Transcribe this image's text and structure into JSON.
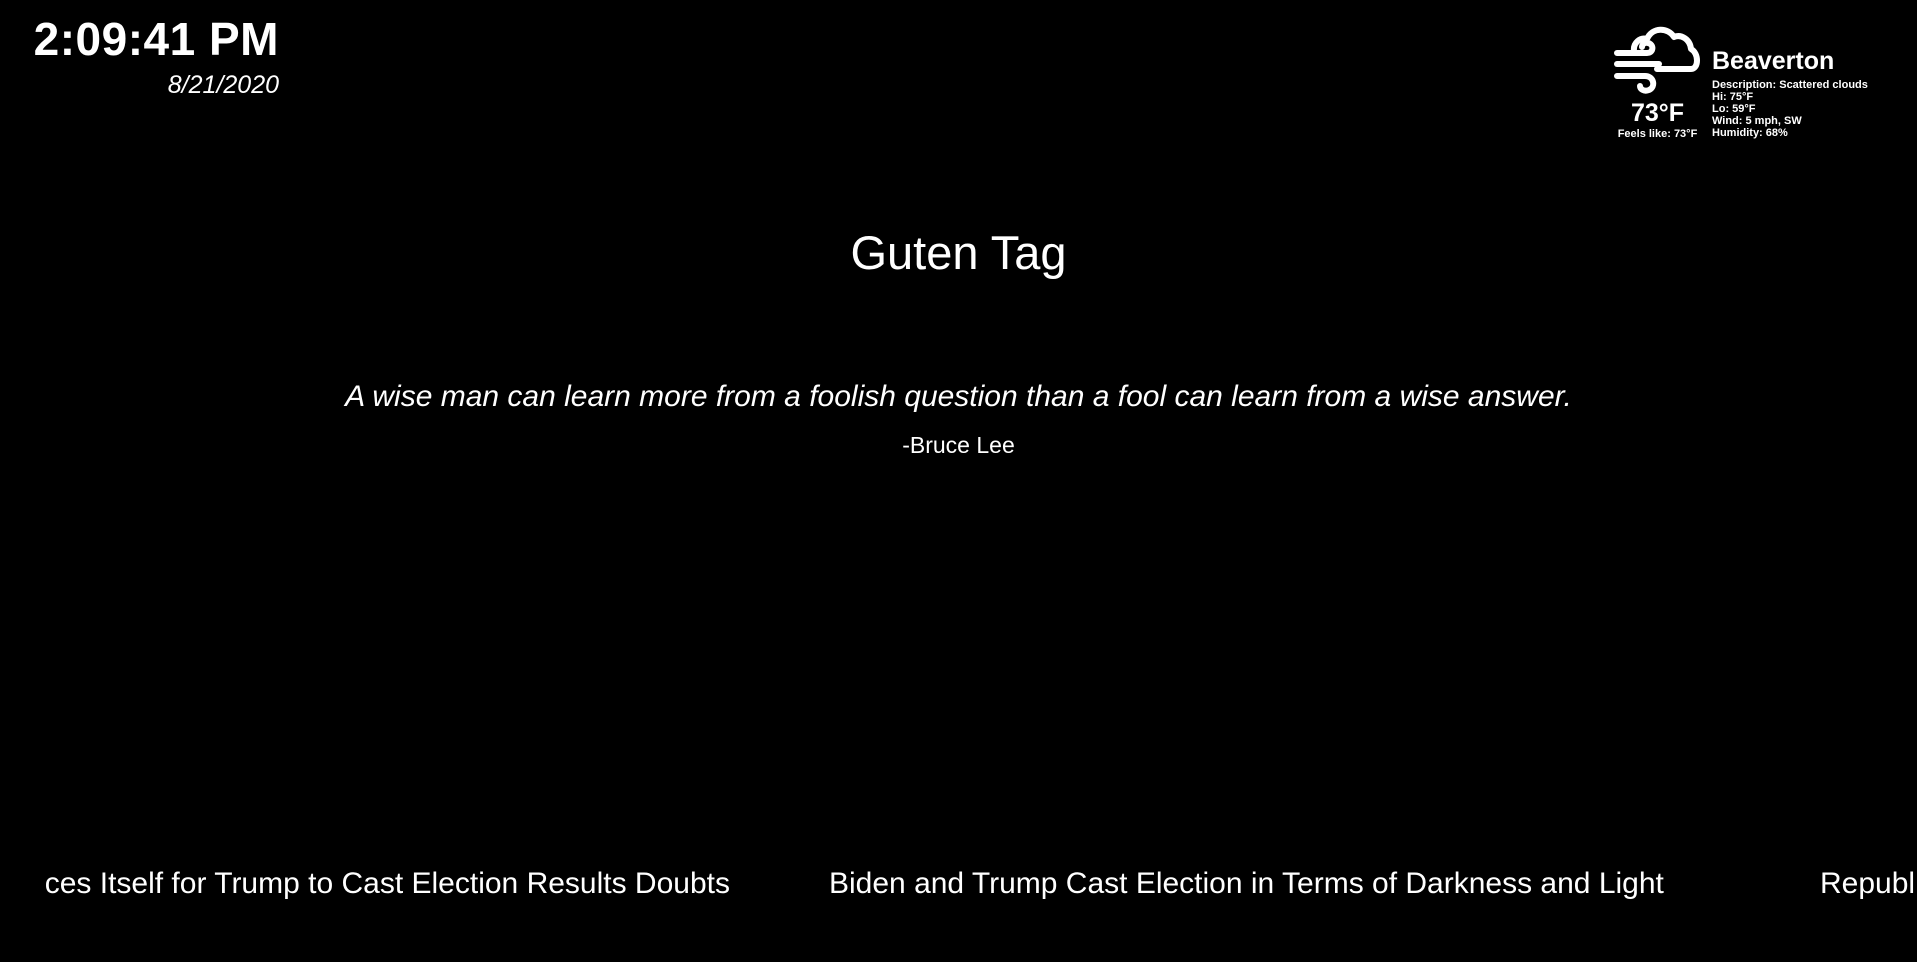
{
  "clock": {
    "time": "2:09:41 PM",
    "date": "8/21/2020"
  },
  "weather": {
    "icon": "cloud-wind-icon",
    "city": "Beaverton",
    "temperature": "73°F",
    "feels_like": "Feels like: 73°F",
    "description": "Description: Scattered clouds",
    "hi": "Hi: 75°F",
    "lo": "Lo: 59°F",
    "wind": "Wind: 5 mph, SW",
    "humidity": "Humidity: 68%"
  },
  "greeting": "Guten Tag",
  "quote": {
    "text": "A wise man can learn more from a foolish question than a fool can learn from a wise answer.",
    "author": "-Bruce Lee"
  },
  "news": {
    "headlines": [
      "ces Itself for Trump to Cast Election Results Doubts",
      "Biden and Trump Cast Election in Terms of Darkness and Light",
      "Republ"
    ]
  },
  "colors": {
    "background": "#000000",
    "text": "#ffffff"
  }
}
